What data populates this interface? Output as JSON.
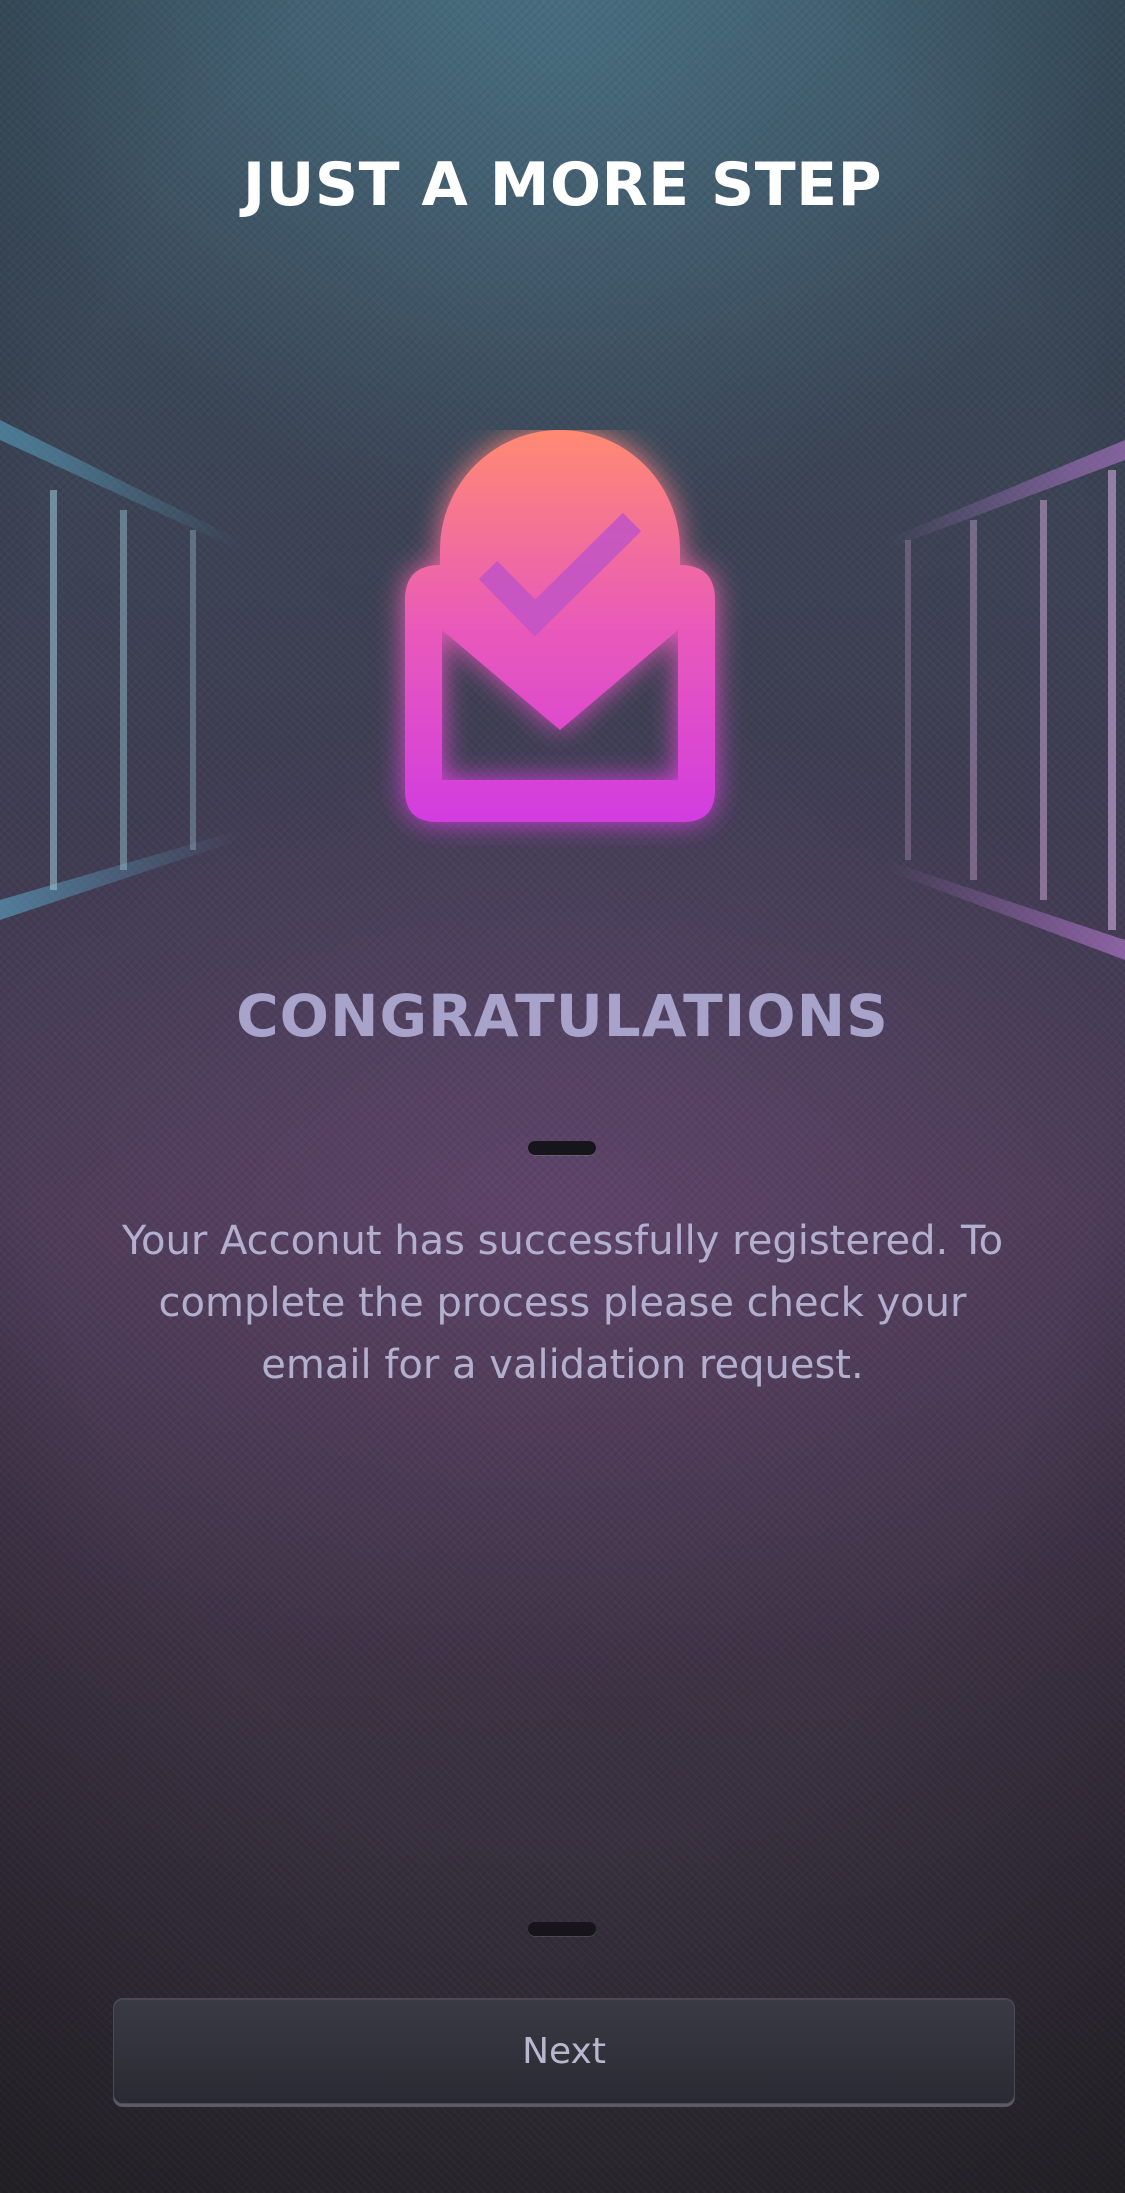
{
  "header": {
    "title": "JUST A MORE STEP"
  },
  "hero": {
    "icon": "mail-check-icon",
    "gradient_top": "#ff8a72",
    "gradient_bottom": "#d23de0"
  },
  "content": {
    "heading": "CONGRATULATIONS",
    "message": "Your Acconut has successfully registered. To complete the process please check your email for a validation request."
  },
  "actions": {
    "next_label": "Next"
  },
  "colors": {
    "heading": "#a7a3cb",
    "message": "#b3b0cf",
    "deco_left": "#5fb3d6",
    "deco_right": "#c883e6"
  }
}
